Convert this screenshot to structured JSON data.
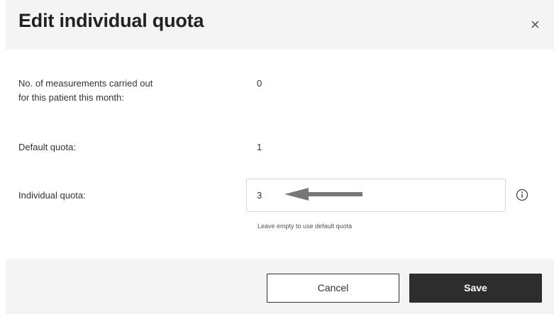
{
  "dialog": {
    "title": "Edit individual quota",
    "close_symbol": "×"
  },
  "fields": {
    "measurements_label_line1": "No. of measurements carried out",
    "measurements_label_line2": "for this patient this month:",
    "measurements_value": "0",
    "default_quota_label": "Default quota:",
    "default_quota_value": "1",
    "individual_quota_label": "Individual quota:",
    "individual_quota_value": "3",
    "individual_quota_help": "Leave empty to use default quota"
  },
  "icons": {
    "close": "close-icon",
    "info": "info-icon",
    "arrow": "arrow-left-icon"
  },
  "footer": {
    "cancel_label": "Cancel",
    "save_label": "Save"
  },
  "colors": {
    "header_bg": "#f4f4f4",
    "footer_bg": "#f4f4f4",
    "save_bg": "#2d2d2d",
    "arrow": "#777777"
  }
}
